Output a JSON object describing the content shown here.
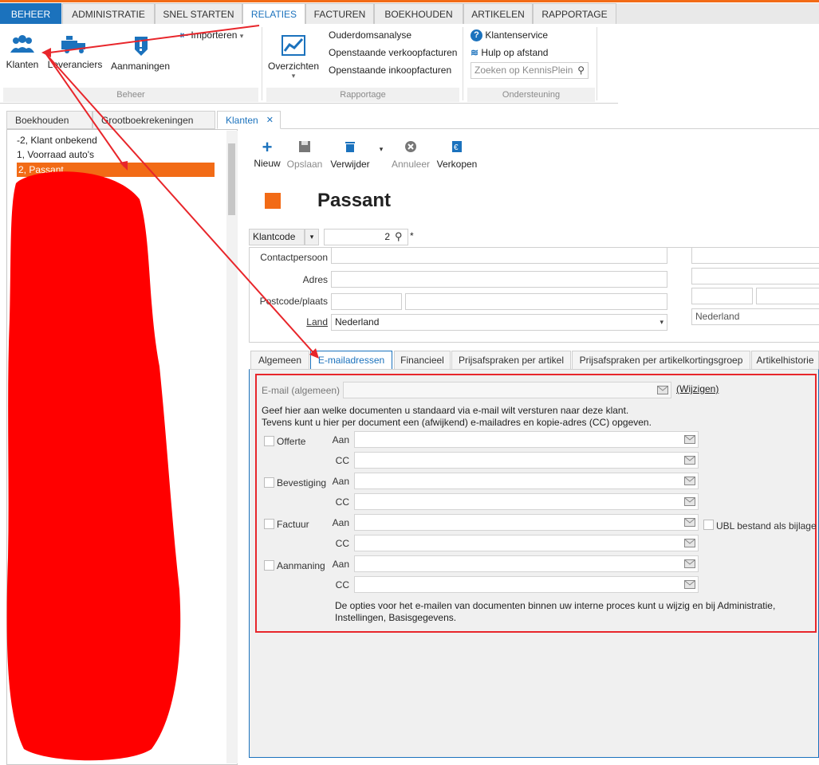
{
  "ribbon": {
    "tabs": [
      "BEHEER",
      "ADMINISTRATIE",
      "SNEL STARTEN",
      "RELATIES",
      "FACTUREN",
      "BOEKHOUDEN",
      "ARTIKELEN",
      "RAPPORTAGE"
    ],
    "beheer": {
      "klanten": "Klanten",
      "leveranciers": "Leveranciers",
      "aanmaningen": "Aanmaningen",
      "importeren": "Importeren",
      "group_label": "Beheer"
    },
    "rapportage": {
      "overzichten": "Overzichten",
      "links": [
        "Ouderdomsanalyse",
        "Openstaande verkoopfacturen",
        "Openstaande inkoopfacturen"
      ],
      "group_label": "Rapportage"
    },
    "ondersteuning": {
      "klantenservice": "Klantenservice",
      "hulp": "Hulp op afstand",
      "search_placeholder": "Zoeken op KennisPlein",
      "group_label": "Ondersteuning"
    }
  },
  "panel_tabs": [
    "Boekhouden",
    "Grootboekrekeningen",
    "Klanten"
  ],
  "panel_close": "✕",
  "customers": [
    "-2, Klant onbekend",
    "1, Voorraad auto's",
    "2,   Passant"
  ],
  "toolbar": {
    "nieuw": "Nieuw",
    "opslaan": "Opslaan",
    "verwijder": "Verwijder",
    "annuleer": "Annuleer",
    "verkopen": "Verkopen"
  },
  "customer": {
    "name": "Passant",
    "color": "#f26b16",
    "klantcode_label": "Klantcode",
    "klantcode_value": "2",
    "required_mark": "*",
    "contactpersoon_label": "Contactpersoon",
    "adres_label": "Adres",
    "postcode_label": "Postcode/plaats",
    "land_label": "Land",
    "land_value": "Nederland",
    "land_value_right": "Nederland"
  },
  "detail_tabs": [
    "Algemeen",
    "E-mailadressen",
    "Financieel",
    "Prijsafspraken per artikel",
    "Prijsafspraken per artikelkortingsgroep",
    "Artikelhistorie"
  ],
  "email": {
    "general_label": "E-mail (algemeen)",
    "wijzigen": "(Wijzigen)",
    "info_line1": "Geef hier aan welke documenten u standaard via e-mail wilt versturen naar deze klant.",
    "info_line2": "Tevens kunt u hier per document een (afwijkend) e-mailadres en kopie-adres (CC) opgeven.",
    "aan": "Aan",
    "cc": "CC",
    "documents": [
      "Offerte",
      "Bevestiging",
      "Factuur",
      "Aanmaning"
    ],
    "ubl_label": "UBL bestand als bijlage",
    "footer_line1": "De opties voor het e-mailen van documenten binnen uw interne proces kunt u wijzig en bij Administratie,",
    "footer_line2": "Instellingen, Basisgegevens."
  },
  "colors": {
    "accent": "#1b72bd",
    "orange": "#f26b16",
    "annotation_red": "#e8262b"
  }
}
